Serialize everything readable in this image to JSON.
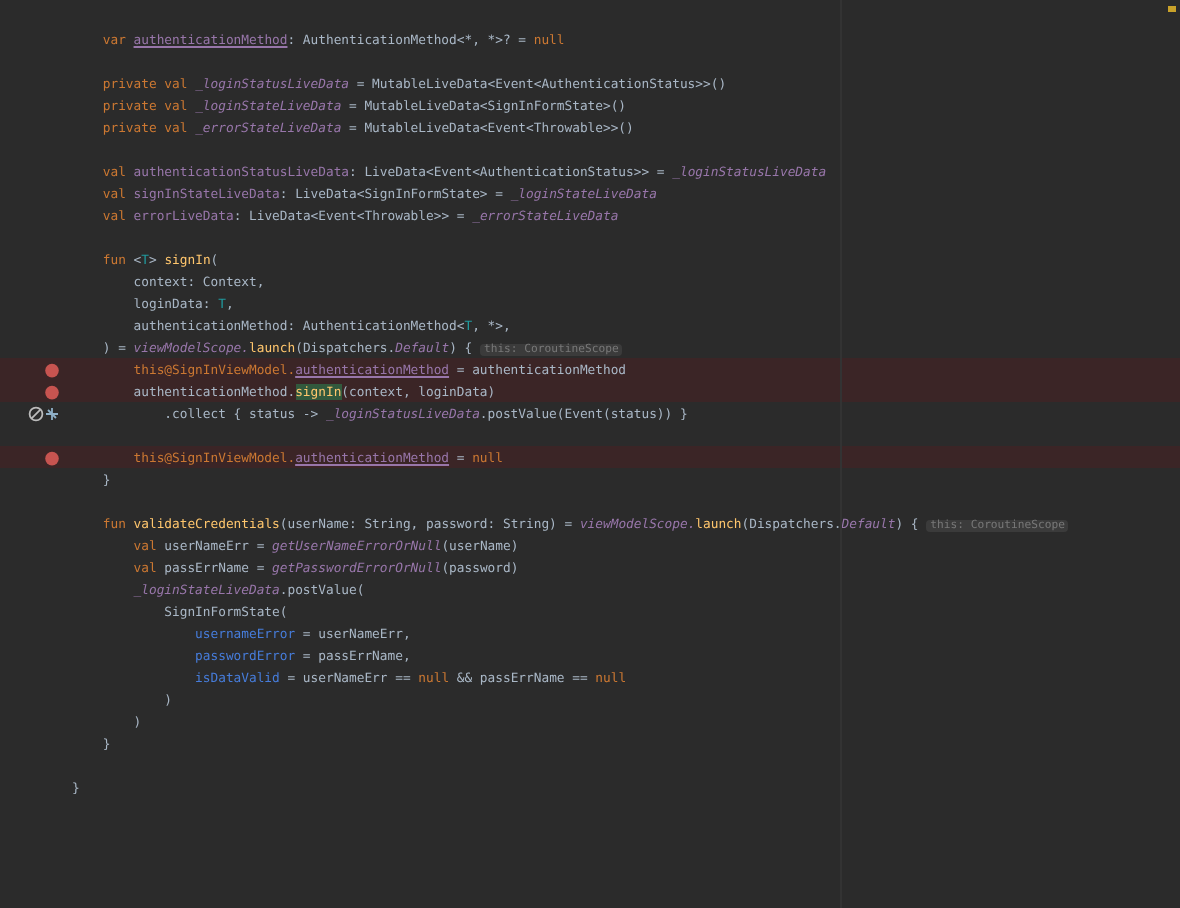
{
  "editor": {
    "blocks": [
      {
        "lines": [
          {
            "breakpoint": false,
            "suspend": false,
            "tokens": [
              {
                "kind": "keyword",
                "text": "    var "
              },
              {
                "kind": "property-underlined",
                "text": "authenticationMethod"
              },
              {
                "kind": "plain",
                "text": ": AuthenticationMethod<*, *>? = "
              },
              {
                "kind": "keyword",
                "text": "null"
              }
            ]
          }
        ]
      },
      {
        "lines": [
          {
            "breakpoint": false,
            "suspend": false,
            "tokens": [
              {
                "kind": "keyword",
                "text": "    private val "
              },
              {
                "kind": "property-italic",
                "text": "_loginStatusLiveData"
              },
              {
                "kind": "plain",
                "text": " = MutableLiveData<Event<AuthenticationStatus>>()"
              }
            ]
          },
          {
            "breakpoint": false,
            "suspend": false,
            "tokens": [
              {
                "kind": "keyword",
                "text": "    private val "
              },
              {
                "kind": "property-italic",
                "text": "_loginStateLiveData"
              },
              {
                "kind": "plain",
                "text": " = MutableLiveData<SignInFormState>()"
              }
            ]
          },
          {
            "breakpoint": false,
            "suspend": false,
            "tokens": [
              {
                "kind": "keyword",
                "text": "    private val "
              },
              {
                "kind": "property-italic",
                "text": "_errorStateLiveData"
              },
              {
                "kind": "plain",
                "text": " = MutableLiveData<Event<Throwable>>()"
              }
            ]
          }
        ]
      },
      {
        "lines": [
          {
            "breakpoint": false,
            "suspend": false,
            "tokens": [
              {
                "kind": "keyword",
                "text": "    val "
              },
              {
                "kind": "property",
                "text": "authenticationStatusLiveData"
              },
              {
                "kind": "plain",
                "text": ": LiveData<Event<AuthenticationStatus>> = "
              },
              {
                "kind": "property-italic",
                "text": "_loginStatusLiveData"
              }
            ]
          },
          {
            "breakpoint": false,
            "suspend": false,
            "tokens": [
              {
                "kind": "keyword",
                "text": "    val "
              },
              {
                "kind": "property",
                "text": "signInStateLiveData"
              },
              {
                "kind": "plain",
                "text": ": LiveData<SignInFormState> = "
              },
              {
                "kind": "property-italic",
                "text": "_loginStateLiveData"
              }
            ]
          },
          {
            "breakpoint": false,
            "suspend": false,
            "tokens": [
              {
                "kind": "keyword",
                "text": "    val "
              },
              {
                "kind": "property",
                "text": "errorLiveData"
              },
              {
                "kind": "plain",
                "text": ": LiveData<Event<Throwable>> = "
              },
              {
                "kind": "property-italic",
                "text": "_errorStateLiveData"
              }
            ]
          }
        ]
      },
      {
        "lines": [
          {
            "breakpoint": false,
            "suspend": false,
            "tokens": [
              {
                "kind": "keyword",
                "text": "    fun "
              },
              {
                "kind": "plain",
                "text": "<"
              },
              {
                "kind": "type-param",
                "text": "T"
              },
              {
                "kind": "plain",
                "text": "> "
              },
              {
                "kind": "function",
                "text": "signIn"
              },
              {
                "kind": "plain",
                "text": "("
              }
            ]
          },
          {
            "breakpoint": false,
            "suspend": false,
            "tokens": [
              {
                "kind": "plain",
                "text": "        context: Context,"
              }
            ]
          },
          {
            "breakpoint": false,
            "suspend": false,
            "tokens": [
              {
                "kind": "plain",
                "text": "        loginData: "
              },
              {
                "kind": "type-param",
                "text": "T"
              },
              {
                "kind": "plain",
                "text": ","
              }
            ]
          },
          {
            "breakpoint": false,
            "suspend": false,
            "tokens": [
              {
                "kind": "plain",
                "text": "        authenticationMethod: AuthenticationMethod<"
              },
              {
                "kind": "type-param",
                "text": "T"
              },
              {
                "kind": "plain",
                "text": ", *>,"
              }
            ]
          },
          {
            "breakpoint": false,
            "suspend": false,
            "tokens": [
              {
                "kind": "plain",
                "text": "    ) = "
              },
              {
                "kind": "call-italic",
                "text": "viewModelScope."
              },
              {
                "kind": "function",
                "text": "launch"
              },
              {
                "kind": "plain",
                "text": "(Dispatchers."
              },
              {
                "kind": "property-italic",
                "text": "Default"
              },
              {
                "kind": "plain",
                "text": ") { "
              },
              {
                "kind": "hint",
                "text": "this: CoroutineScope"
              }
            ]
          },
          {
            "breakpoint": true,
            "suspend": false,
            "tokens": [
              {
                "kind": "keyword",
                "text": "        this@SignInViewModel."
              },
              {
                "kind": "property-underlined",
                "text": "authenticationMethod"
              },
              {
                "kind": "plain",
                "text": " = authenticationMethod"
              }
            ]
          },
          {
            "breakpoint": true,
            "suspend": false,
            "tokens": [
              {
                "kind": "plain",
                "text": "        authenticationMethod."
              },
              {
                "kind": "function-highlighted",
                "text": "signIn"
              },
              {
                "kind": "plain",
                "text": "(context, loginData)"
              }
            ]
          },
          {
            "breakpoint": false,
            "suspend": true,
            "tokens": [
              {
                "kind": "plain",
                "text": "            .collect { status -> "
              },
              {
                "kind": "property-italic",
                "text": "_loginStatusLiveData"
              },
              {
                "kind": "plain",
                "text": ".postValue(Event(status)) }"
              }
            ]
          }
        ]
      },
      {
        "lines": [
          {
            "breakpoint": true,
            "suspend": false,
            "tokens": [
              {
                "kind": "keyword",
                "text": "        this@SignInViewModel."
              },
              {
                "kind": "property-underlined",
                "text": "authenticationMethod"
              },
              {
                "kind": "plain",
                "text": " = "
              },
              {
                "kind": "keyword",
                "text": "null"
              }
            ]
          },
          {
            "breakpoint": false,
            "suspend": false,
            "tokens": [
              {
                "kind": "plain",
                "text": "    }"
              }
            ]
          }
        ]
      },
      {
        "lines": [
          {
            "breakpoint": false,
            "suspend": false,
            "tokens": [
              {
                "kind": "keyword",
                "text": "    fun "
              },
              {
                "kind": "function",
                "text": "validateCredentials"
              },
              {
                "kind": "plain",
                "text": "(userName: String, password: String) = "
              },
              {
                "kind": "call-italic",
                "text": "viewModelScope."
              },
              {
                "kind": "function",
                "text": "launch"
              },
              {
                "kind": "plain",
                "text": "(Dispatchers."
              },
              {
                "kind": "property-italic",
                "text": "Default"
              },
              {
                "kind": "plain",
                "text": ") { "
              },
              {
                "kind": "hint",
                "text": "this: CoroutineScope"
              }
            ]
          },
          {
            "breakpoint": false,
            "suspend": false,
            "tokens": [
              {
                "kind": "keyword",
                "text": "        val "
              },
              {
                "kind": "plain",
                "text": "userNameErr = "
              },
              {
                "kind": "call-italic",
                "text": "getUserNameErrorOrNull"
              },
              {
                "kind": "plain",
                "text": "(userName)"
              }
            ]
          },
          {
            "breakpoint": false,
            "suspend": false,
            "tokens": [
              {
                "kind": "keyword",
                "text": "        val "
              },
              {
                "kind": "plain",
                "text": "passErrName = "
              },
              {
                "kind": "call-italic",
                "text": "getPasswordErrorOrNull"
              },
              {
                "kind": "plain",
                "text": "(password)"
              }
            ]
          },
          {
            "breakpoint": false,
            "suspend": false,
            "tokens": [
              {
                "kind": "property-italic",
                "text": "        _loginStateLiveData"
              },
              {
                "kind": "plain",
                "text": ".postValue("
              }
            ]
          },
          {
            "breakpoint": false,
            "suspend": false,
            "tokens": [
              {
                "kind": "plain",
                "text": "            SignInFormState("
              }
            ]
          },
          {
            "breakpoint": false,
            "suspend": false,
            "tokens": [
              {
                "kind": "named-arg",
                "text": "                usernameError"
              },
              {
                "kind": "plain",
                "text": " = userNameErr,"
              }
            ]
          },
          {
            "breakpoint": false,
            "suspend": false,
            "tokens": [
              {
                "kind": "named-arg",
                "text": "                passwordError"
              },
              {
                "kind": "plain",
                "text": " = passErrName,"
              }
            ]
          },
          {
            "breakpoint": false,
            "suspend": false,
            "tokens": [
              {
                "kind": "named-arg",
                "text": "                isDataValid"
              },
              {
                "kind": "plain",
                "text": " = userNameErr == "
              },
              {
                "kind": "keyword",
                "text": "null"
              },
              {
                "kind": "plain",
                "text": " && passErrName == "
              },
              {
                "kind": "keyword",
                "text": "null"
              }
            ]
          },
          {
            "breakpoint": false,
            "suspend": false,
            "tokens": [
              {
                "kind": "plain",
                "text": "            )"
              }
            ]
          },
          {
            "breakpoint": false,
            "suspend": false,
            "tokens": [
              {
                "kind": "plain",
                "text": "        )"
              }
            ]
          },
          {
            "breakpoint": false,
            "suspend": false,
            "tokens": [
              {
                "kind": "plain",
                "text": "    }"
              }
            ]
          }
        ]
      },
      {
        "lines": [
          {
            "breakpoint": false,
            "suspend": false,
            "tokens": [
              {
                "kind": "plain",
                "text": "}"
              }
            ]
          }
        ]
      }
    ]
  }
}
